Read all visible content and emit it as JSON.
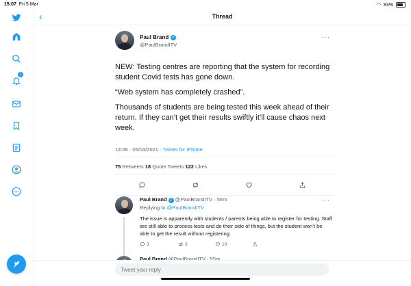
{
  "status_bar": {
    "time": "15:07",
    "date": "Fri 5 Mar",
    "battery": "83%"
  },
  "sidebar": {
    "notifications_badge": "1",
    "items": [
      "twitter-logo",
      "home",
      "explore",
      "notifications",
      "messages",
      "bookmarks",
      "lists",
      "profile",
      "more"
    ]
  },
  "header": {
    "back": "‹",
    "title": "Thread"
  },
  "main_tweet": {
    "name": "Paul Brand",
    "handle": "@PaulBrandITV",
    "more": "···",
    "paragraphs": [
      "NEW: Testing centres are reporting that the system for recording student Covid tests has gone down.",
      "“Web system has completely crashed”.",
      "Thousands of students are being tested this week ahead of their return. If they can’t get their results swiftly it’ll cause chaos next week."
    ],
    "timestamp": "14:06 · 05/03/2021 · ",
    "source": "Twitter for iPhone",
    "retweets": "75",
    "retweets_label": " Retweets  ",
    "quotes": "18",
    "quotes_label": " Quote Tweets  ",
    "likes": "122",
    "likes_label": " Likes"
  },
  "reply_tweet": {
    "name": "Paul Brand",
    "handle_time": " @PaulBrandITV · 56m",
    "replying_prefix": "Replying to ",
    "replying_to": "@PaulBrandITV",
    "text": "The issue is apparently with students / parents being able to register for testing. Staff are still able to process tests and do their side of things, but the student won’t be able to get the result without registering.",
    "reply_count": "3",
    "retweet_count": "3",
    "like_count": "10"
  },
  "next_tweet": {
    "name": "Paul Brand",
    "handle_time": " @PaulBrandITV · 55m"
  },
  "compose": {
    "placeholder": "Tweet your reply"
  },
  "colors": {
    "accent": "#1d9bf0",
    "text": "#0f1419",
    "muted": "#536471"
  }
}
